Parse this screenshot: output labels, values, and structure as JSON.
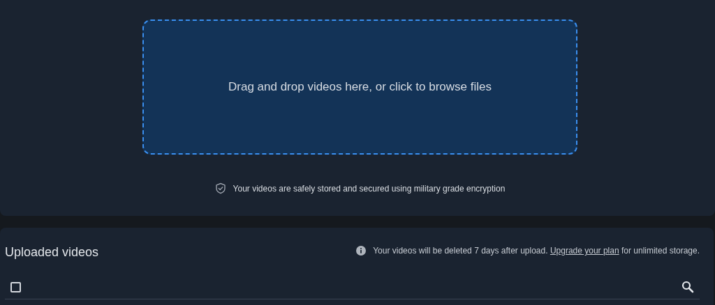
{
  "dropzone": {
    "text": "Drag and drop videos here, or click to browse files"
  },
  "security_note": "Your videos are safely stored and secured using military grade encryption",
  "uploaded": {
    "title": "Uploaded videos",
    "notice": {
      "before": "Your videos will be deleted 7 days after upload. ",
      "link": "Upgrade your plan",
      "after": " for unlimited storage."
    },
    "select_all": {
      "checked": false
    }
  }
}
